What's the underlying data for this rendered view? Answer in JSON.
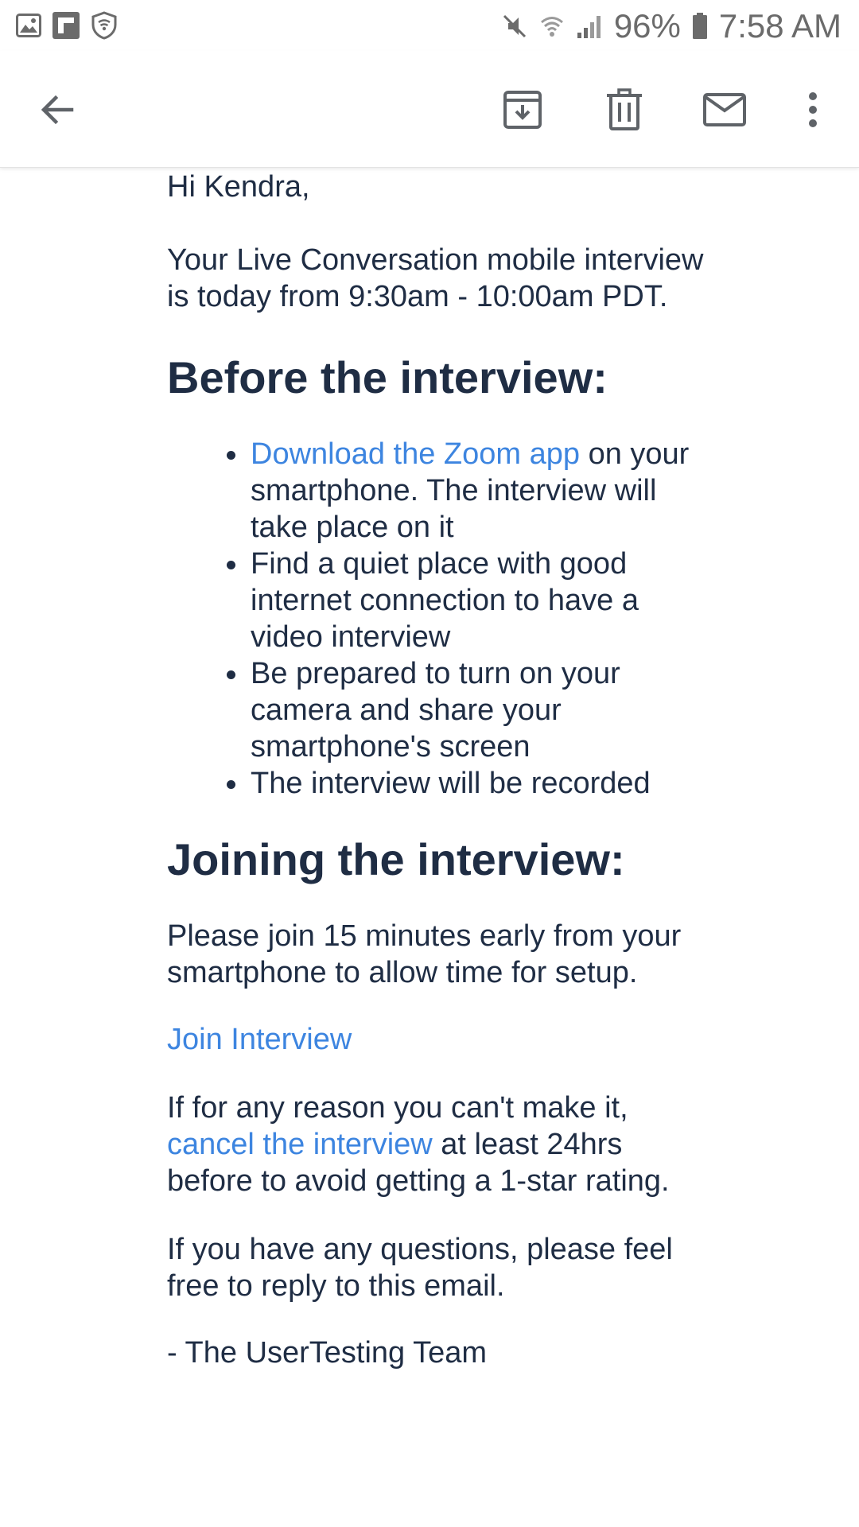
{
  "status_bar": {
    "battery": "96%",
    "time": "7:58 AM",
    "left_icons": [
      "gallery-icon",
      "flipboard-icon",
      "shield-icon"
    ],
    "right_icons": [
      "mute-icon",
      "wifi-icon",
      "signal-icon",
      "battery-icon"
    ]
  },
  "app_bar": {
    "icons": [
      "back-arrow-icon",
      "archive-icon",
      "delete-icon",
      "mark-unread-icon",
      "more-vert-icon"
    ]
  },
  "email": {
    "greeting": "Hi Kendra,",
    "intro": "Your Live Conversation mobile interview is today from 9:30am - 10:00am PDT.",
    "before_heading": "Before the interview:",
    "bullets": {
      "item1_link": "Download the Zoom app",
      "item1_text": " on your smartphone. The interview will take place on it",
      "item2": "Find a quiet place with good internet connection to have a video interview",
      "item3": "Be prepared to turn on your camera and share your smartphone's screen",
      "item4": "The interview will be recorded"
    },
    "joining_heading": "Joining the interview:",
    "join_text": "Please join 15 minutes early from your smartphone to allow time for setup.",
    "join_link": "Join Interview",
    "cancel_prefix": "If for any reason you can't make it, ",
    "cancel_link": "cancel the interview",
    "cancel_suffix": " at least 24hrs before to avoid getting a 1-star rating.",
    "questions": "If you have any questions, please feel free to reply to this email.",
    "signature": "- The UserTesting Team"
  },
  "colors": {
    "text": "#1f2d44",
    "link": "#3d85e0",
    "icon": "#5f6368",
    "status": "#6b6b6b"
  }
}
